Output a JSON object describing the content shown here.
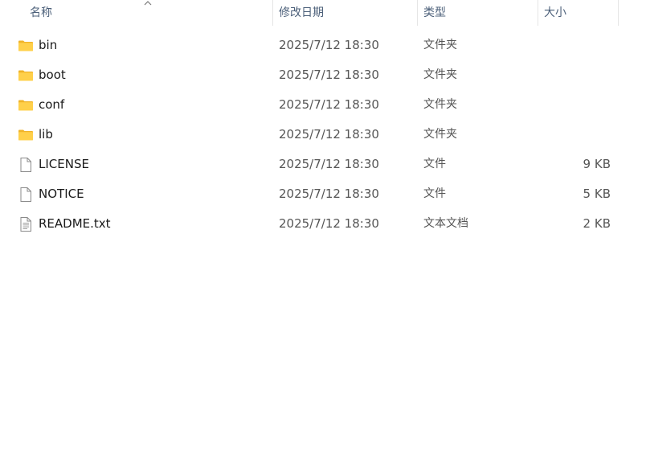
{
  "columns": {
    "name": "名称",
    "modified": "修改日期",
    "type": "类型",
    "size": "大小"
  },
  "sort": {
    "column": "name",
    "direction": "ascending",
    "icon": "chevron-up-icon"
  },
  "files": [
    {
      "name": "bin",
      "modified": "2025/7/12 18:30",
      "type": "文件夹",
      "size": "",
      "icon": "folder-icon"
    },
    {
      "name": "boot",
      "modified": "2025/7/12 18:30",
      "type": "文件夹",
      "size": "",
      "icon": "folder-icon"
    },
    {
      "name": "conf",
      "modified": "2025/7/12 18:30",
      "type": "文件夹",
      "size": "",
      "icon": "folder-icon"
    },
    {
      "name": "lib",
      "modified": "2025/7/12 18:30",
      "type": "文件夹",
      "size": "",
      "icon": "folder-icon"
    },
    {
      "name": "LICENSE",
      "modified": "2025/7/12 18:30",
      "type": "文件",
      "size": "9 KB",
      "icon": "file-icon"
    },
    {
      "name": "NOTICE",
      "modified": "2025/7/12 18:30",
      "type": "文件",
      "size": "5 KB",
      "icon": "file-icon"
    },
    {
      "name": "README.txt",
      "modified": "2025/7/12 18:30",
      "type": "文本文档",
      "size": "2 KB",
      "icon": "text-document-icon"
    }
  ],
  "colors": {
    "header_text": "#4c607a",
    "folder_fill": "#ffd04a",
    "folder_tab": "#f0b429"
  }
}
